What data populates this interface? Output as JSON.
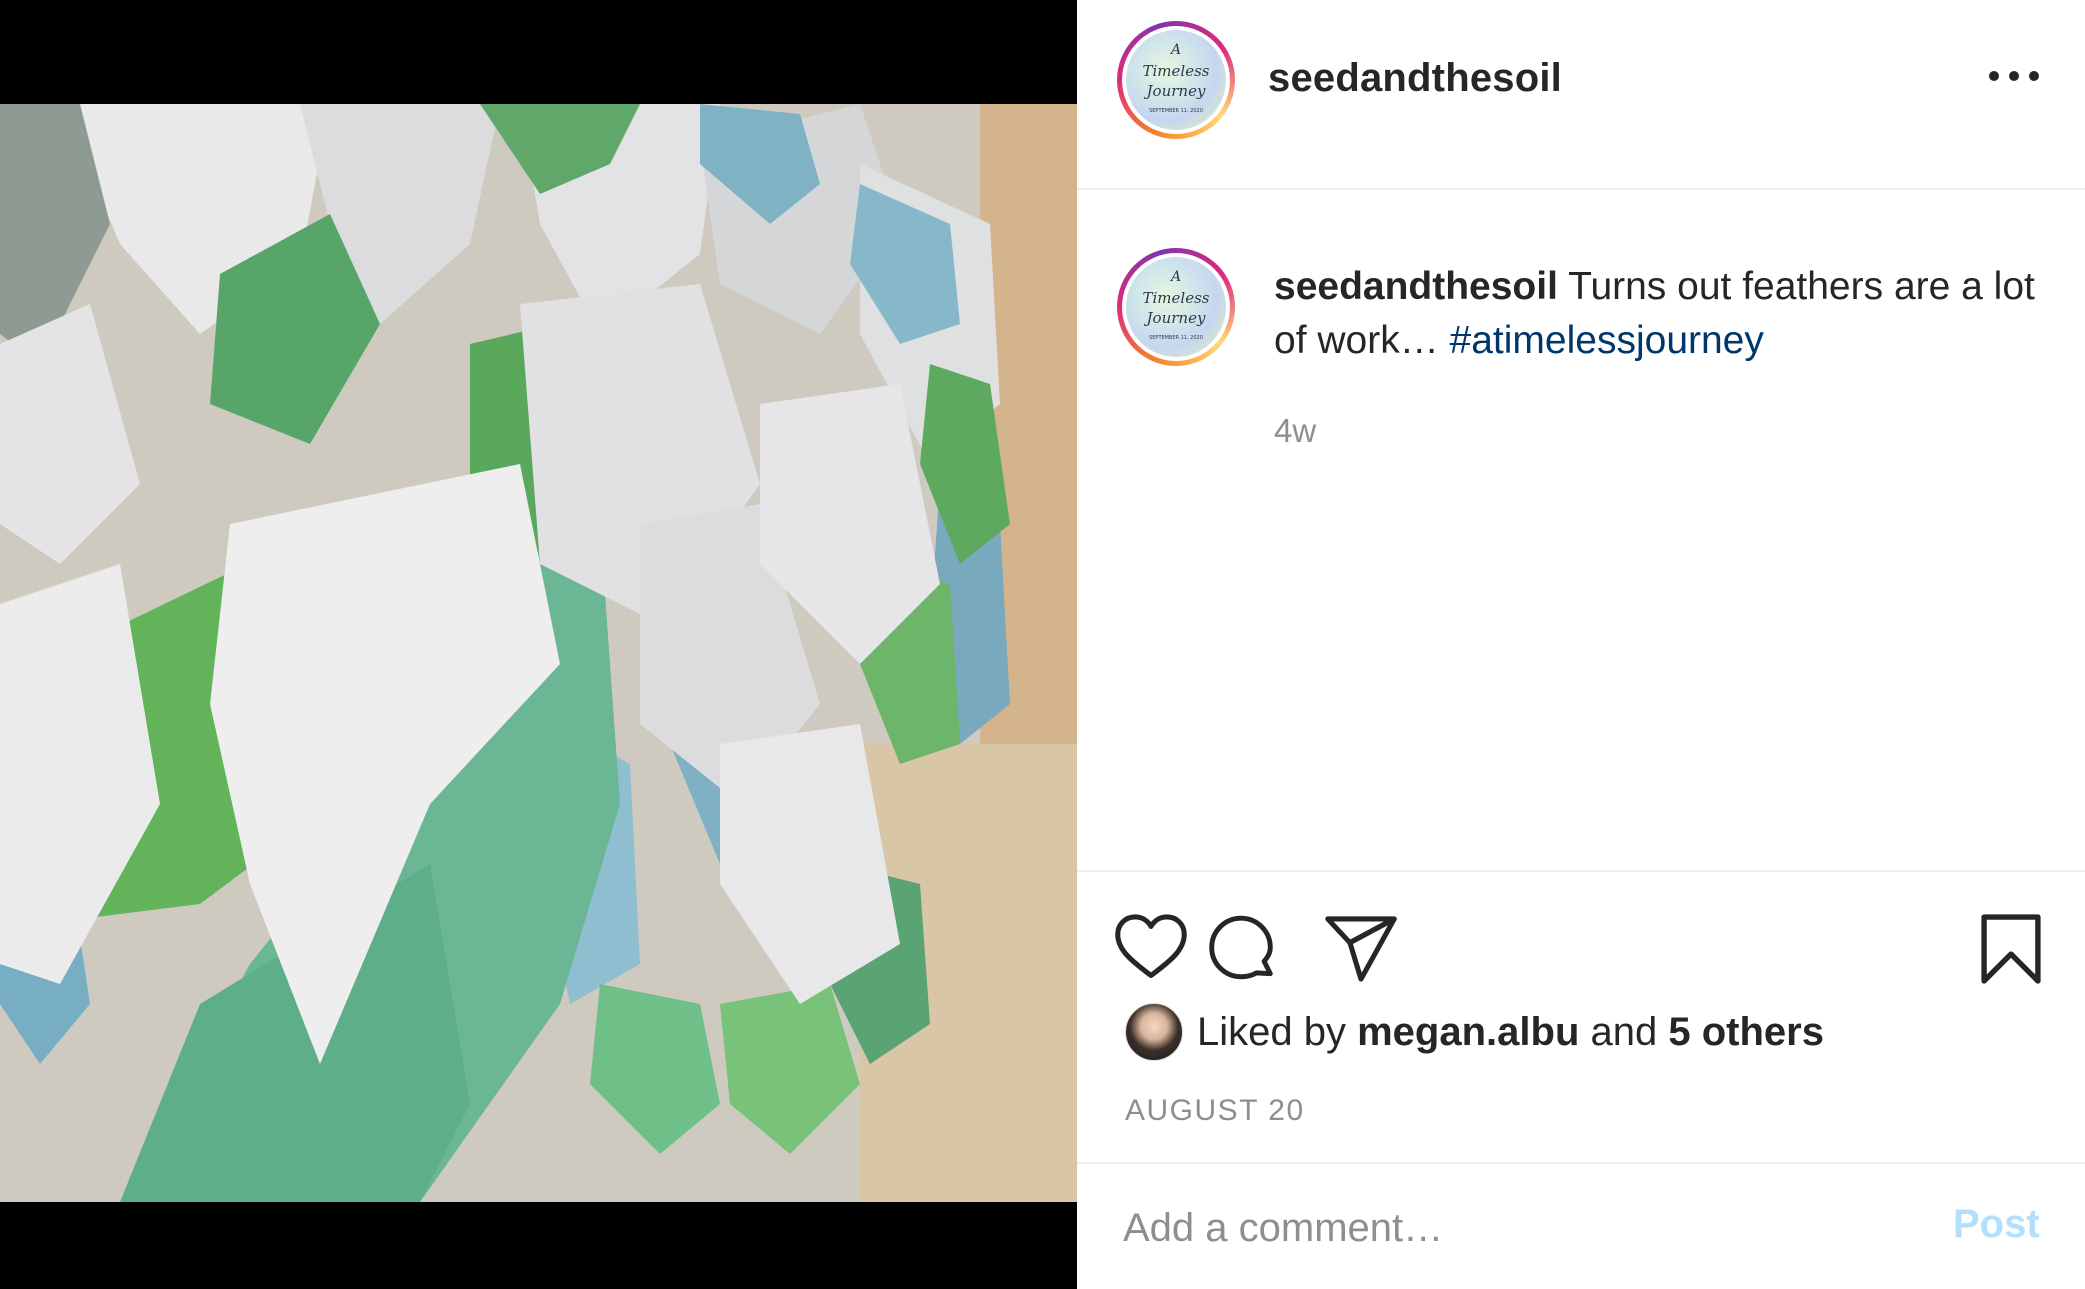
{
  "post": {
    "username": "seedandthesoil",
    "caption": {
      "username": "seedandthesoil",
      "text": "Turns out feathers are a lot of work…",
      "hashtag": "#atimelessjourney"
    },
    "time_ago": "4w",
    "avatar_text": {
      "line1": "A",
      "line2": "Timeless",
      "line3": "Journey",
      "line4": "SEPTEMBER 11, 2020"
    },
    "likes": {
      "prefix": "Liked by",
      "user": "megan.albu",
      "joiner": "and",
      "others": "5 others"
    },
    "date": "AUGUST 20",
    "comment": {
      "placeholder": "Add a comment…",
      "post_label": "Post"
    },
    "icons": {
      "more": "more-options-icon",
      "like": "heart-icon",
      "comment": "comment-icon",
      "share": "share-icon",
      "save": "bookmark-icon"
    },
    "colors": {
      "hashtag": "#00376b",
      "post_button_disabled": "#b2dffc",
      "secondary_text": "#8e8e8e"
    }
  }
}
